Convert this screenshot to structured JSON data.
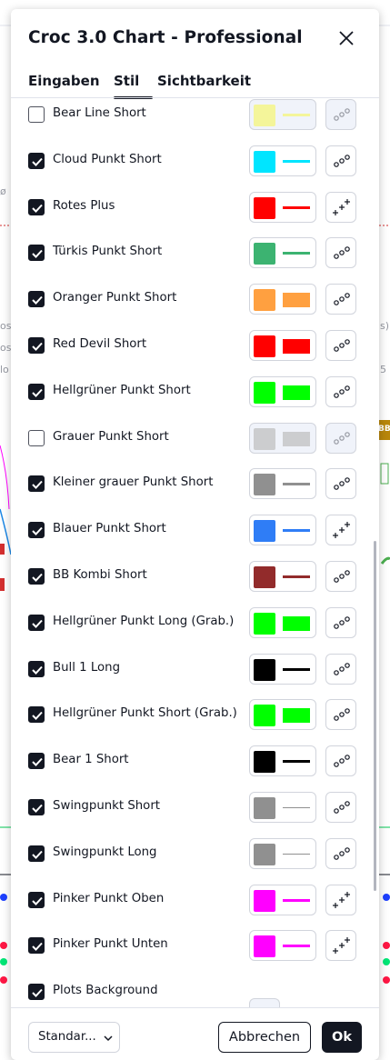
{
  "background": {
    "fragment_symbol": "ø",
    "fragment_os_1": "os",
    "fragment_os_2": "os",
    "fragment_os_right": "s)",
    "fragment_lo": "lo",
    "fragment_num": "5 -",
    "badge_label": "BB"
  },
  "dialog": {
    "title": "Croc 3.0 Chart - Professional",
    "close_icon": "close-icon",
    "tabs": [
      {
        "label": "Eingaben",
        "active": false
      },
      {
        "label": "Stil",
        "active": true
      },
      {
        "label": "Sichtbarkeit",
        "active": false
      }
    ]
  },
  "rows": [
    {
      "label": "Bear Line Short",
      "checked": false,
      "color": "#f5f57a",
      "sample": "line",
      "style_icon": "dots-icon"
    },
    {
      "label": "Cloud Punkt Short",
      "checked": true,
      "color": "#00e5ff",
      "sample": "line",
      "style_icon": "dots-icon"
    },
    {
      "label": "Rotes Plus",
      "checked": true,
      "color": "#ff0000",
      "sample": "line",
      "style_icon": "crosses-icon"
    },
    {
      "label": "Türkis Punkt Short",
      "checked": true,
      "color": "#3cb371",
      "sample": "line",
      "style_icon": "dots-icon"
    },
    {
      "label": "Oranger Punkt Short",
      "checked": true,
      "color": "#ffa040",
      "sample": "block",
      "style_icon": "dots-icon"
    },
    {
      "label": "Red Devil Short",
      "checked": true,
      "color": "#ff0000",
      "sample": "block",
      "style_icon": "dots-icon"
    },
    {
      "label": "Hellgrüner Punkt Short",
      "checked": true,
      "color": "#00ff00",
      "sample": "block",
      "style_icon": "dots-icon"
    },
    {
      "label": "Grauer Punkt Short",
      "checked": false,
      "color": "#c0c0c0",
      "sample": "block",
      "style_icon": "dots-icon"
    },
    {
      "label": "Kleiner grauer Punkt Short",
      "checked": true,
      "color": "#909090",
      "sample": "line",
      "style_icon": "dots-icon"
    },
    {
      "label": "Blauer Punkt Short",
      "checked": true,
      "color": "#2f7df6",
      "sample": "line",
      "style_icon": "crosses-icon"
    },
    {
      "label": "BB Kombi Short",
      "checked": true,
      "color": "#922b2b",
      "sample": "line",
      "style_icon": "dots-icon"
    },
    {
      "label": "Hellgrüner Punkt Long (Grab.)",
      "checked": true,
      "color": "#00ff00",
      "sample": "block",
      "style_icon": "dots-icon"
    },
    {
      "label": "Bull 1 Long",
      "checked": true,
      "color": "#000000",
      "sample": "thick",
      "style_icon": "dots-icon"
    },
    {
      "label": "Hellgrüner Punkt Short (Grab.)",
      "checked": true,
      "color": "#00ff00",
      "sample": "block",
      "style_icon": "dots-icon"
    },
    {
      "label": "Bear 1 Short",
      "checked": true,
      "color": "#000000",
      "sample": "thick",
      "style_icon": "dots-icon"
    },
    {
      "label": "Swingpunkt Short",
      "checked": true,
      "color": "#909090",
      "sample": "thin",
      "style_icon": "dots-icon"
    },
    {
      "label": "Swingpunkt Long",
      "checked": true,
      "color": "#909090",
      "sample": "thin",
      "style_icon": "dots-icon"
    },
    {
      "label": "Pinker Punkt Oben",
      "checked": true,
      "color": "#ff00ff",
      "sample": "line",
      "style_icon": "crosses-icon"
    },
    {
      "label": "Pinker Punkt Unten",
      "checked": true,
      "color": "#ff00ff",
      "sample": "line",
      "style_icon": "crosses-icon"
    },
    {
      "label": "Plots Background",
      "checked": true
    }
  ],
  "footer": {
    "preset_value": "Standar...",
    "cancel_label": "Abbrechen",
    "ok_label": "Ok"
  },
  "colors": {
    "text": "#131722",
    "border": "#d1d4dc",
    "checkbox_on": "#131722"
  }
}
